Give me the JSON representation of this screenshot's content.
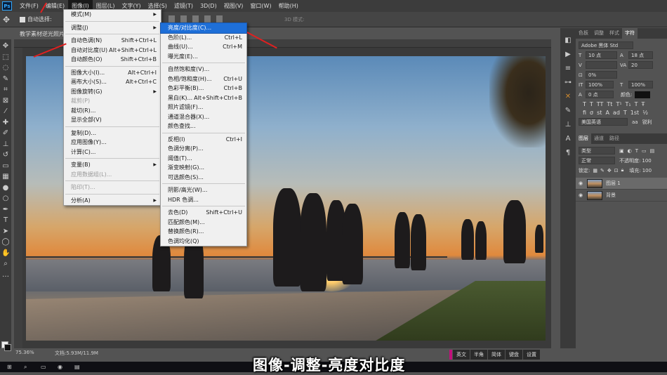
{
  "menubar": {
    "logo": "Ps",
    "items": [
      "文件(F)",
      "编辑(E)",
      "图像(I)",
      "图层(L)",
      "文字(Y)",
      "选择(S)",
      "滤镜(T)",
      "3D(D)",
      "视图(V)",
      "窗口(W)",
      "帮助(H)"
    ],
    "active_index": 2
  },
  "options": {
    "auto_select_label": "自动选择:",
    "mode_3d": "3D 模式:"
  },
  "document": {
    "tab_title": "教学素材逆光照片",
    "zoom": "75.36%",
    "doc_size": "文档:5.93M/11.9M"
  },
  "image_menu": {
    "items": [
      {
        "label": "模式(M)",
        "shortcut": "",
        "submenu": true,
        "disabled": false
      },
      {
        "sep": true
      },
      {
        "label": "调整(J)",
        "shortcut": "",
        "submenu": true,
        "disabled": false
      },
      {
        "sep": true
      },
      {
        "label": "自动色调(N)",
        "shortcut": "Shift+Ctrl+L",
        "disabled": false
      },
      {
        "label": "自动对比度(U)",
        "shortcut": "Alt+Shift+Ctrl+L",
        "disabled": false
      },
      {
        "label": "自动颜色(O)",
        "shortcut": "Shift+Ctrl+B",
        "disabled": false
      },
      {
        "sep": true
      },
      {
        "label": "图像大小(I)...",
        "shortcut": "Alt+Ctrl+I",
        "disabled": false
      },
      {
        "label": "画布大小(S)...",
        "shortcut": "Alt+Ctrl+C",
        "disabled": false
      },
      {
        "label": "图像旋转(G)",
        "shortcut": "",
        "submenu": true,
        "disabled": false
      },
      {
        "label": "裁剪(P)",
        "shortcut": "",
        "disabled": true
      },
      {
        "label": "裁切(R)...",
        "shortcut": "",
        "disabled": false
      },
      {
        "label": "显示全部(V)",
        "shortcut": "",
        "disabled": false
      },
      {
        "sep": true
      },
      {
        "label": "复制(D)...",
        "shortcut": "",
        "disabled": false
      },
      {
        "label": "应用图像(Y)...",
        "shortcut": "",
        "disabled": false
      },
      {
        "label": "计算(C)...",
        "shortcut": "",
        "disabled": false
      },
      {
        "sep": true
      },
      {
        "label": "变量(B)",
        "shortcut": "",
        "submenu": true,
        "disabled": false
      },
      {
        "label": "应用数据组(L)...",
        "shortcut": "",
        "disabled": true
      },
      {
        "sep": true
      },
      {
        "label": "陷印(T)...",
        "shortcut": "",
        "disabled": true
      },
      {
        "sep": true
      },
      {
        "label": "分析(A)",
        "shortcut": "",
        "submenu": true,
        "disabled": false
      }
    ]
  },
  "adjust_menu": {
    "items": [
      {
        "label": "亮度/对比度(C)...",
        "shortcut": "",
        "highlight": true
      },
      {
        "label": "色阶(L)...",
        "shortcut": "Ctrl+L"
      },
      {
        "label": "曲线(U)...",
        "shortcut": "Ctrl+M"
      },
      {
        "label": "曝光度(E)...",
        "shortcut": ""
      },
      {
        "sep": true
      },
      {
        "label": "自然饱和度(V)...",
        "shortcut": ""
      },
      {
        "label": "色相/饱和度(H)...",
        "shortcut": "Ctrl+U"
      },
      {
        "label": "色彩平衡(B)...",
        "shortcut": "Ctrl+B"
      },
      {
        "label": "黑白(K)...",
        "shortcut": "Alt+Shift+Ctrl+B"
      },
      {
        "label": "照片滤镜(F)...",
        "shortcut": ""
      },
      {
        "label": "通道混合器(X)...",
        "shortcut": ""
      },
      {
        "label": "颜色查找...",
        "shortcut": ""
      },
      {
        "sep": true
      },
      {
        "label": "反相(I)",
        "shortcut": "Ctrl+I"
      },
      {
        "label": "色调分离(P)...",
        "shortcut": ""
      },
      {
        "label": "阈值(T)...",
        "shortcut": ""
      },
      {
        "label": "渐变映射(G)...",
        "shortcut": ""
      },
      {
        "label": "可选颜色(S)...",
        "shortcut": ""
      },
      {
        "sep": true
      },
      {
        "label": "阴影/高光(W)...",
        "shortcut": ""
      },
      {
        "label": "HDR 色调...",
        "shortcut": ""
      },
      {
        "sep": true
      },
      {
        "label": "去色(D)",
        "shortcut": "Shift+Ctrl+U"
      },
      {
        "label": "匹配颜色(M)...",
        "shortcut": ""
      },
      {
        "label": "替换颜色(R)...",
        "shortcut": ""
      },
      {
        "label": "色调均化(Q)",
        "shortcut": ""
      }
    ]
  },
  "right_panel": {
    "tabs": [
      "色板",
      "调整",
      "样式",
      "字符"
    ],
    "active_tab": 3,
    "font": "Adobe 黑体 Std",
    "size1": "10 点",
    "size2": "18 点",
    "leading": "20",
    "tracking": "0%",
    "scale_v": "100%",
    "scale_h": "100%",
    "baseline": "0 点",
    "color_label": "颜色:",
    "language": "美国英语",
    "aa_label": "aa",
    "aa_value": "锐利",
    "layers_tabs": [
      "图层",
      "通道",
      "路径"
    ],
    "filter_label": "类型",
    "blend_mode": "正常",
    "opacity_label": "不透明度:",
    "opacity_value": "100",
    "lock_label": "锁定:",
    "fill_label": "填充:",
    "fill_value": "100",
    "layers": [
      {
        "name": "图层 1",
        "selected": true
      },
      {
        "name": "背景",
        "selected": false
      }
    ]
  },
  "status_strip": [
    "英文",
    "半角",
    "简体",
    "键盘",
    "设置"
  ],
  "subtitle": "图像-调整-亮度对比度"
}
